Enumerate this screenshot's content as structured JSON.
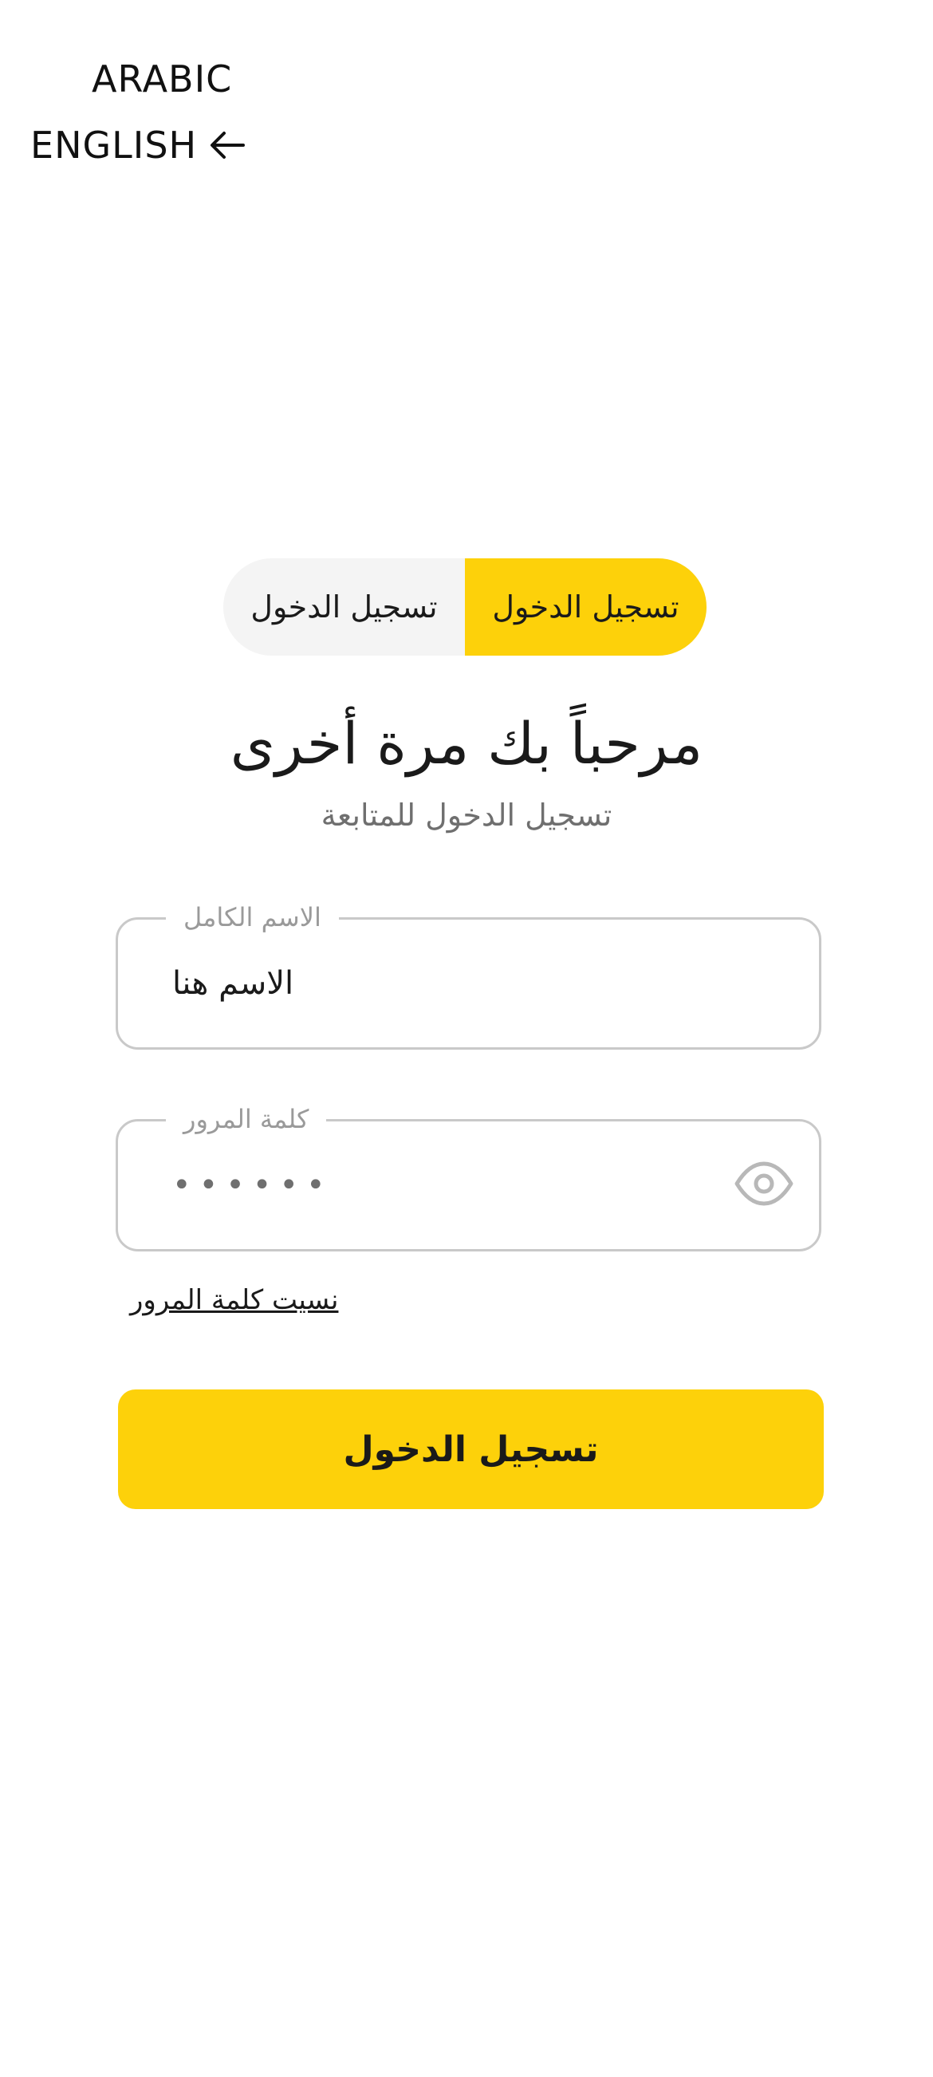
{
  "language": {
    "arabic_label": "ARABIC",
    "english_label": "ENGLISH",
    "english_icon": "arrow-left-icon"
  },
  "toggle": {
    "active_label": "تسجيل الدخول",
    "inactive_label": "تسجيل الدخول"
  },
  "header": {
    "title": "مرحباً بك مرة أخرى",
    "subtitle": "تسجيل الدخول للمتابعة"
  },
  "form": {
    "username": {
      "label": "الاسم الكامل",
      "value": "الاسم هنا"
    },
    "password": {
      "label": "كلمة المرور",
      "value": "••••••",
      "icon": "eye-icon"
    },
    "forgot_label": "نسيت كلمة المرور",
    "submit_label": "تسجيل الدخول"
  },
  "colors": {
    "accent": "#fdd10a",
    "toggle_bg": "#f4f4f4",
    "border": "#c9c9c9"
  }
}
